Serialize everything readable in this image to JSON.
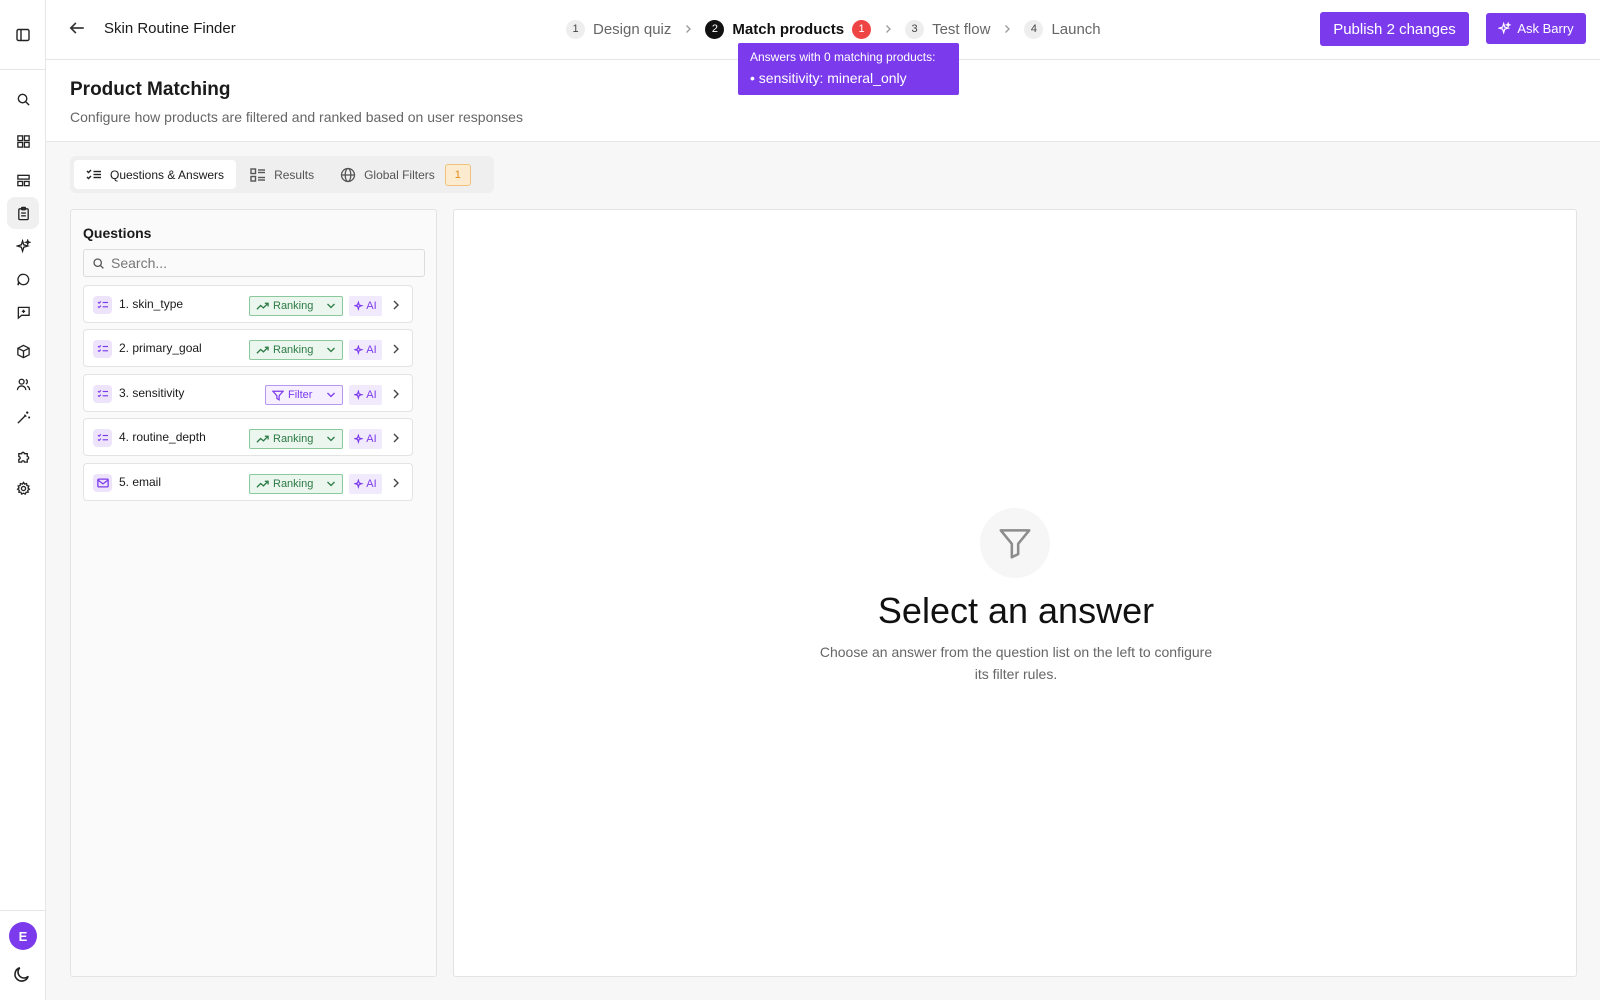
{
  "app": {
    "title": "Skin Routine Finder"
  },
  "steps": [
    {
      "num": "1",
      "label": "Design quiz"
    },
    {
      "num": "2",
      "label": "Match products",
      "badge": "1"
    },
    {
      "num": "3",
      "label": "Test flow"
    },
    {
      "num": "4",
      "label": "Launch"
    }
  ],
  "actions": {
    "publish": "Publish 2 changes",
    "ask": "Ask Barry"
  },
  "tooltip": {
    "line1": "Answers with 0 matching products:",
    "line2": "• sensitivity: mineral_only"
  },
  "header": {
    "title": "Product Matching",
    "subtitle": "Configure how products are filtered and ranked based on user responses"
  },
  "tabs": [
    {
      "label": "Questions & Answers"
    },
    {
      "label": "Results"
    },
    {
      "label": "Global Filters",
      "badge": "1"
    }
  ],
  "questions": {
    "heading": "Questions",
    "search_placeholder": "Search...",
    "items": [
      {
        "label": "1. skin_type",
        "mode": "Ranking",
        "ai": "AI"
      },
      {
        "label": "2. primary_goal",
        "mode": "Ranking",
        "ai": "AI"
      },
      {
        "label": "3. sensitivity",
        "mode": "Filter",
        "ai": "AI"
      },
      {
        "label": "4. routine_depth",
        "mode": "Ranking",
        "ai": "AI"
      },
      {
        "label": "5. email",
        "mode": "Ranking",
        "ai": "AI"
      }
    ]
  },
  "empty": {
    "title": "Select an answer",
    "desc": "Choose an answer from the question list on the left to configure its filter rules."
  },
  "user": {
    "initial": "E"
  },
  "colors": {
    "accent": "#7c3aed",
    "error": "#ef4444",
    "ranking": "#2d7a44"
  }
}
